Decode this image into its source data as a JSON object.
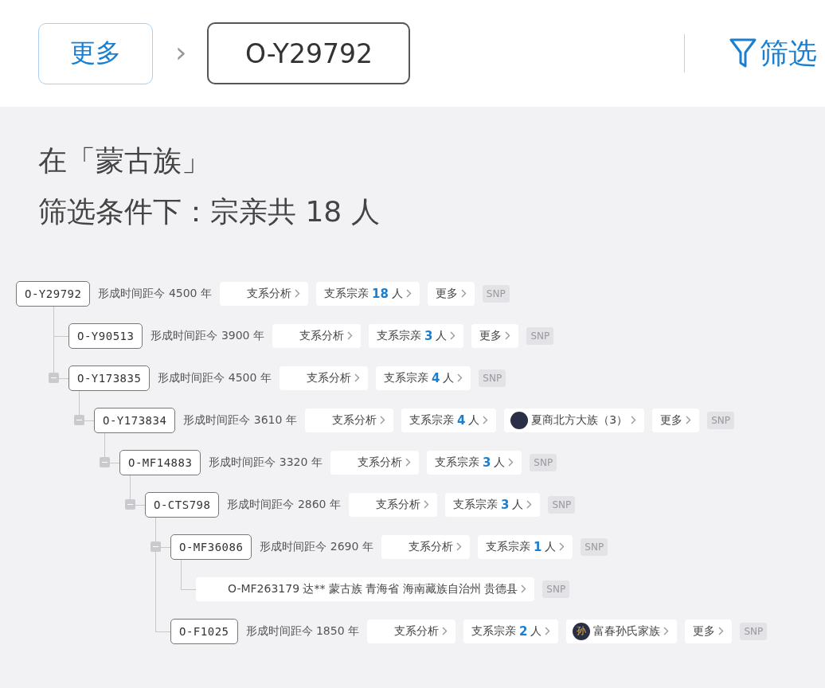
{
  "header": {
    "more_button": "更多",
    "separator": "›",
    "current_id": "O-Y29792",
    "filter_button": "筛选"
  },
  "summary": {
    "line_1": "在「蒙古族」",
    "line_2": "筛选条件下：宗亲共 18 人"
  },
  "tree": {
    "kind": "node",
    "id": "O-Y29792",
    "age": "形成时间距今 4500 年",
    "chips": [
      {
        "kind": "analysis",
        "label": "支系分析"
      },
      {
        "kind": "kin",
        "label": "支系宗亲",
        "count": "18",
        "unit": "人"
      },
      {
        "kind": "more",
        "label": "更多"
      }
    ],
    "snp": "SNP",
    "children": [
      {
        "kind": "node",
        "id": "O-Y90513",
        "age": "形成时间距今 3900 年",
        "chips": [
          {
            "kind": "analysis",
            "label": "支系分析"
          },
          {
            "kind": "kin",
            "label": "支系宗亲",
            "count": "3",
            "unit": "人"
          },
          {
            "kind": "more",
            "label": "更多"
          }
        ],
        "snp": "SNP"
      },
      {
        "kind": "node",
        "id": "O-Y173835",
        "expanded": true,
        "age": "形成时间距今 4500 年",
        "chips": [
          {
            "kind": "analysis",
            "label": "支系分析"
          },
          {
            "kind": "kin",
            "label": "支系宗亲",
            "count": "4",
            "unit": "人"
          }
        ],
        "snp": "SNP",
        "children": [
          {
            "kind": "node",
            "id": "O-Y173834",
            "expanded": true,
            "age": "形成时间距今 3610 年",
            "chips": [
              {
                "kind": "analysis",
                "label": "支系分析"
              },
              {
                "kind": "kin",
                "label": "支系宗亲",
                "count": "4",
                "unit": "人"
              },
              {
                "kind": "clan",
                "label": "夏商北方大族（3）"
              },
              {
                "kind": "more",
                "label": "更多"
              }
            ],
            "snp": "SNP",
            "children": [
              {
                "kind": "node",
                "id": "O-MF14883",
                "expanded": true,
                "age": "形成时间距今 3320 年",
                "chips": [
                  {
                    "kind": "analysis",
                    "label": "支系分析"
                  },
                  {
                    "kind": "kin",
                    "label": "支系宗亲",
                    "count": "3",
                    "unit": "人"
                  }
                ],
                "snp": "SNP",
                "children": [
                  {
                    "kind": "node",
                    "id": "O-CTS798",
                    "expanded": true,
                    "age": "形成时间距今 2860 年",
                    "chips": [
                      {
                        "kind": "analysis",
                        "label": "支系分析"
                      },
                      {
                        "kind": "kin",
                        "label": "支系宗亲",
                        "count": "3",
                        "unit": "人"
                      }
                    ],
                    "snp": "SNP",
                    "children": [
                      {
                        "kind": "node",
                        "id": "O-MF36086",
                        "expanded": true,
                        "age": "形成时间距今 2690 年",
                        "chips": [
                          {
                            "kind": "analysis",
                            "label": "支系分析"
                          },
                          {
                            "kind": "kin",
                            "label": "支系宗亲",
                            "count": "1",
                            "unit": "人"
                          }
                        ],
                        "snp": "SNP",
                        "children": [
                          {
                            "kind": "person",
                            "label": "O-MF263179 达** 蒙古族 青海省 海南藏族自治州 贵德县",
                            "snp": "SNP"
                          }
                        ]
                      },
                      {
                        "kind": "node",
                        "id": "O-F1025",
                        "age": "形成时间距今 1850 年",
                        "chips": [
                          {
                            "kind": "analysis",
                            "label": "支系分析"
                          },
                          {
                            "kind": "kin",
                            "label": "支系宗亲",
                            "count": "2",
                            "unit": "人"
                          },
                          {
                            "kind": "clan",
                            "label": "富春孙氏家族",
                            "avatar_text": "孙"
                          },
                          {
                            "kind": "more",
                            "label": "更多"
                          }
                        ],
                        "snp": "SNP"
                      }
                    ]
                  }
                ]
              }
            ]
          }
        ]
      }
    ]
  }
}
